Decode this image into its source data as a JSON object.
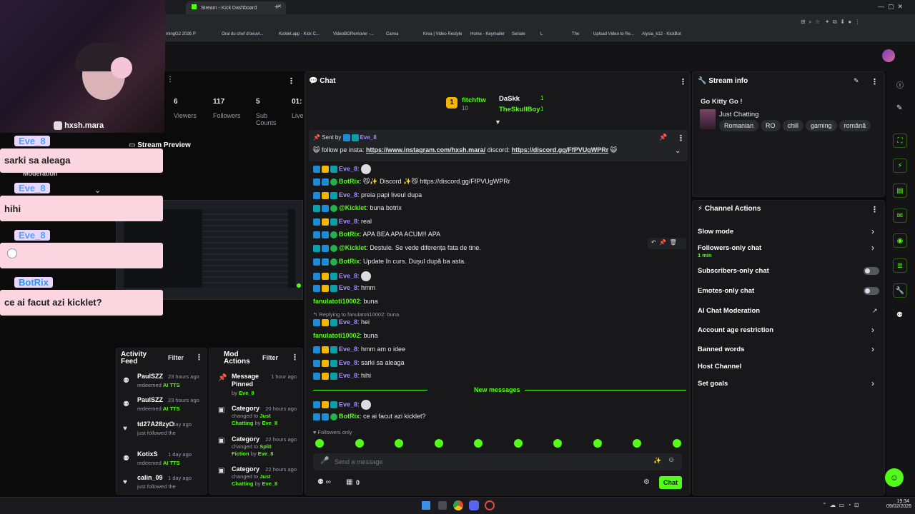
{
  "browser": {
    "tabs": [
      {
        "label": "Stream - Kick Dashboard"
      }
    ],
    "bookmarks": [
      "mingG2 2026",
      "P",
      "Oral du chef d'oeuvr...",
      "Kicklet.app - Kick C...",
      "VideoBGRemover -...",
      "Canva",
      "Krea | Video Restyle",
      "Home - Keymailer",
      "Seriale",
      "L",
      "The",
      "Upload Video to Re...",
      "Alysia_k12 - KickBot"
    ]
  },
  "overlay": {
    "instagram": "hxsh.mara",
    "messages": [
      {
        "user": "Eve_8",
        "text": "sarki sa aleaga"
      },
      {
        "user": "Eve_8",
        "text": "hihi"
      },
      {
        "user": "Eve_8",
        "text": ""
      },
      {
        "user": "BotRix",
        "text": "ce ai facut azi kicklet?"
      }
    ]
  },
  "stats": [
    {
      "value": "6",
      "label": "Viewers"
    },
    {
      "value": "117",
      "label": "Followers"
    },
    {
      "value": "5",
      "label": "Sub Counts"
    },
    {
      "value": "01:",
      "label": "Live"
    }
  ],
  "stream_preview": {
    "title": "Stream Preview"
  },
  "moderation_label": "Moderation",
  "chat": {
    "title": "Chat",
    "leaderboard": [
      {
        "name": "fitchftw",
        "count": "10"
      },
      {
        "name": "DaSkk",
        "count": "1"
      },
      {
        "name": "TheSkullBoy",
        "count": "1"
      }
    ],
    "pinned": {
      "sent_by_label": "Sent by",
      "user": "Eve_8",
      "text_prefix": "follow pe insta:",
      "link1": "https://www.instagram.com/hxsh.mara/",
      "mid": "discord:",
      "link2": "https://discord.gg/FfPVUgWPRr"
    },
    "messages": [
      {
        "user": "Eve_8",
        "text": "",
        "color": "#a58cff"
      },
      {
        "user": "BotRix",
        "text": "😼✨ Discord ✨😼 https://discord.gg/FfPVUgWPRr",
        "color": "#53fc18"
      },
      {
        "user": "Eve_8",
        "text": "preia papi liveul dupa",
        "color": "#a58cff"
      },
      {
        "user": "@Kicklet",
        "text": "buna botrix",
        "color": "#53fc18"
      },
      {
        "user": "Eve_8",
        "text": "real",
        "color": "#a58cff"
      },
      {
        "user": "BotRix",
        "text": "APA BEA APA ACUM!! APA",
        "color": "#53fc18"
      },
      {
        "user": "@Kicklet",
        "text": "Destule. Se vede diferența fata de tine.",
        "color": "#53fc18"
      },
      {
        "user": "BotRix",
        "text": "Update în curs. Dușul după ba asta.",
        "color": "#53fc18"
      },
      {
        "user": "Eve_8",
        "text": "",
        "color": "#a58cff"
      },
      {
        "user": "Eve_8",
        "text": "hmm",
        "color": "#a58cff"
      },
      {
        "user": "fanulatoti10002",
        "text": "buna",
        "color": "#53fc18"
      },
      {
        "user": "Eve_8",
        "text": "hei",
        "color": "#a58cff"
      },
      {
        "user": "fanulatoti10002",
        "text": "buna",
        "color": "#53fc18"
      },
      {
        "user": "Eve_8",
        "text": "hmm am o idee",
        "color": "#a58cff"
      },
      {
        "user": "Eve_8",
        "text": "sarki sa aleaga",
        "color": "#a58cff"
      },
      {
        "user": "Eve_8",
        "text": "hihi",
        "color": "#a58cff"
      },
      {
        "user": "Eve_8",
        "text": "",
        "color": "#a58cff"
      },
      {
        "user": "BotRix",
        "text": "ce ai facut azi kicklet?",
        "color": "#53fc18"
      }
    ],
    "reply_label": "Replying to fanulatoti10002: buna",
    "new_messages": "New messages",
    "followers_only": "Followers only",
    "input_placeholder": "Send a message",
    "count": "0",
    "send_label": "Chat"
  },
  "activity": {
    "title": "Activity Feed",
    "filter": "Filter",
    "items": [
      {
        "name": "PaulSZZ",
        "time": "23 hours ago",
        "desc": "redeemed",
        "reward": "AI TTS"
      },
      {
        "name": "PaulSZZ",
        "time": "23 hours ago",
        "desc": "redeemed",
        "reward": "AI TTS"
      },
      {
        "name": "td27A28zyO",
        "time": "1 day ago",
        "desc": "just followed the",
        "reward": ""
      },
      {
        "name": "KotixS",
        "time": "1 day ago",
        "desc": "redeemed",
        "reward": "AI TTS"
      },
      {
        "name": "calin_09",
        "time": "1 day ago",
        "desc": "just followed the",
        "reward": ""
      }
    ]
  },
  "mod_actions": {
    "title": "Mod Actions",
    "filter": "Filter",
    "items": [
      {
        "title": "Message Pinned",
        "time": "1 hour ago",
        "by": "Eve_8",
        "change": "",
        "value": ""
      },
      {
        "title": "Category",
        "time": "20 hours ago",
        "by": "Eve_8",
        "change": "changed to",
        "value": "Just Chatting"
      },
      {
        "title": "Category",
        "time": "22 hours ago",
        "by": "Eve_8",
        "change": "changed to",
        "value": "Split Fiction"
      },
      {
        "title": "Category",
        "time": "22 hours ago",
        "by": "Eve_8",
        "change": "changed to",
        "value": "Just Chatting"
      }
    ]
  },
  "stream_info": {
    "title": "Stream info",
    "stream_title": "Go Kitty Go !",
    "category": "Just Chatting",
    "tags": [
      "Romanian",
      "RO",
      "chill",
      "gaming",
      "română"
    ]
  },
  "channel_actions": {
    "title": "Channel Actions",
    "items": [
      {
        "label": "Slow mode",
        "control": "chevron"
      },
      {
        "label": "Followers-only chat",
        "sub": "1 min",
        "control": "chevron"
      },
      {
        "label": "Subscribers-only chat",
        "control": "toggle"
      },
      {
        "label": "Emotes-only chat",
        "control": "toggle"
      },
      {
        "label": "AI Chat Moderation",
        "control": "external"
      },
      {
        "label": "Account age restriction",
        "control": "chevron"
      },
      {
        "label": "Banned words",
        "control": "chevron"
      },
      {
        "label": "Host Channel",
        "control": "none"
      },
      {
        "label": "Set goals",
        "control": "chevron"
      }
    ]
  },
  "taskbar": {
    "time": "19:34",
    "date": "09/02/2026"
  },
  "colors": {
    "accent": "#53fc18",
    "panel": "#18181b",
    "overlay": "#fbd5df"
  }
}
